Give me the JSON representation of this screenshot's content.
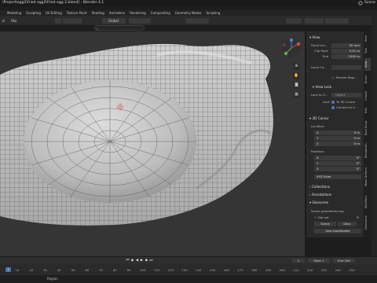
{
  "window": {
    "title": "\\Project\\egg2\\fried egg2\\fried egg 2.blend] - Blender 4.1",
    "scene_label": "Scene"
  },
  "menu": {
    "tabs": [
      "Modeling",
      "Sculpting",
      "UV Editing",
      "Texture Paint",
      "Shading",
      "Animation",
      "Rendering",
      "Compositing",
      "Geometry Nodes",
      "Scripting"
    ]
  },
  "header": {
    "left_label_1": "d",
    "left_label_2": "Obj",
    "transform_orientation": "Global",
    "search_placeholder": "",
    "options_label": "Options"
  },
  "npanel": {
    "view_title": "View",
    "focal_label": "Focal Len...",
    "focal_value": "50 mm",
    "clip_start_label": "Clip Start",
    "clip_start_value": "0.01 m",
    "end_label": "End",
    "end_value": "1000 m",
    "local_cam_label": "Local Ca...",
    "render_region_label": "Render Regi...",
    "view_lock_title": "View Lock",
    "lock_to_label": "Lock to O...",
    "lock_to_value": "Object",
    "lock_label": "Lock",
    "lock_3d_cursor": "To 3D Cursor",
    "camera_to_view": "Camera to V...",
    "cursor_title": "3D Cursor",
    "location_label": "Location:",
    "loc": [
      {
        "axis": "X",
        "value": "0 m"
      },
      {
        "axis": "Y",
        "value": "0 m"
      },
      {
        "axis": "Z",
        "value": "0 m"
      }
    ],
    "rotation_label": "Rotation:",
    "rot": [
      {
        "axis": "X",
        "value": "0°"
      },
      {
        "axis": "Y",
        "value": "0°"
      },
      {
        "axis": "Z",
        "value": "0°"
      }
    ],
    "rotation_mode": "XYZ Euler",
    "collections_title": "Collections",
    "annotations_title": "Annotations",
    "geoscene_title": "Geoscene",
    "georef_label": "Scene georeferencing",
    "not_set": "Not set",
    "geo_btn_1": "Scene",
    "geo_btn_2": "Geor.",
    "geo_coords_btn": "Geo coordinates"
  },
  "sidetabs": [
    "Item",
    "Tool",
    "View",
    "Bimrs",
    "Create",
    "Edit",
    "Real Snow",
    "BlenderKit",
    "Mesh Deform",
    "Modifiers",
    "Geoscene",
    "Wave"
  ],
  "timeline": {
    "frame_current": "1",
    "start_label": "Start",
    "start_value": "1",
    "end_label": "End",
    "end_value": "250",
    "ruler": [
      "10",
      "20",
      "30",
      "40",
      "50",
      "60",
      "70",
      "80",
      "90",
      "100",
      "110",
      "120",
      "130",
      "140",
      "150",
      "160",
      "170",
      "180",
      "190",
      "200",
      "210",
      "220",
      "230",
      "240",
      "250"
    ]
  },
  "status": {
    "region_label": "Region"
  },
  "colors": {
    "accent": "#4772b3",
    "mesh": "#c9c9c9",
    "wire": "#4a4a4a",
    "bg": "#353535"
  }
}
